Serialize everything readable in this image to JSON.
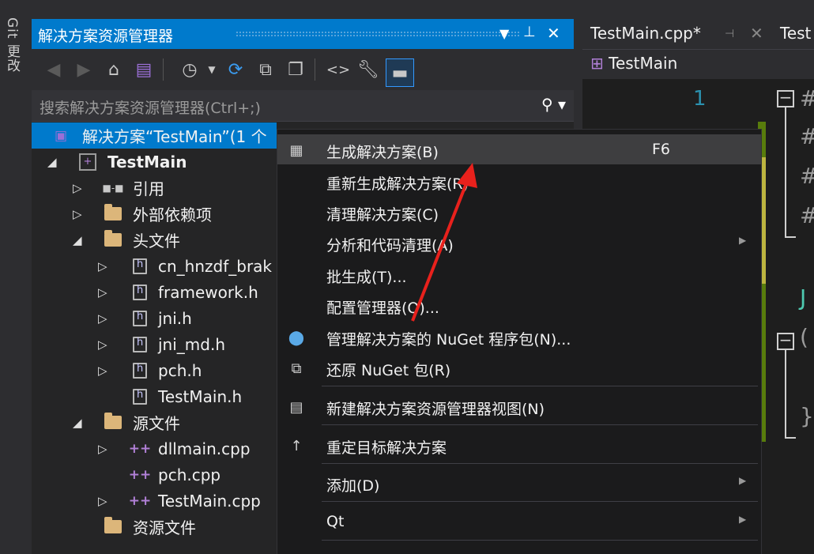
{
  "left_strip": {
    "label": "Git 更改"
  },
  "solution_explorer": {
    "title": "解决方案资源管理器",
    "title_controls": [
      "▼",
      "📌",
      "✕"
    ],
    "search_placeholder": "搜索解决方案资源管理器(Ctrl+;)",
    "tree": {
      "solution": "解决方案“TestMain”(1 个",
      "project": "TestMain",
      "references": "引用",
      "external_deps": "外部依赖项",
      "header_folder": "头文件",
      "headers": [
        "cn_hnzdf_brak",
        "framework.h",
        "jni.h",
        "jni_md.h",
        "pch.h",
        "TestMain.h"
      ],
      "source_folder": "源文件",
      "sources": [
        "dllmain.cpp",
        "pch.cpp",
        "TestMain.cpp"
      ],
      "resource_folder": "资源文件"
    }
  },
  "editor": {
    "tabs": [
      "TestMain.cpp*",
      "Test"
    ],
    "nav_scope": "TestMain",
    "line_number": "1"
  },
  "context_menu": {
    "items": [
      {
        "label": "生成解决方案(B)",
        "shortcut": "F6"
      },
      {
        "label": "重新生成解决方案(R)"
      },
      {
        "label": "清理解决方案(C)"
      },
      {
        "label": "分析和代码清理(A)"
      },
      {
        "label": "批生成(T)..."
      },
      {
        "label": "配置管理器(O)..."
      },
      {
        "label": "管理解决方案的 NuGet 程序包(N)..."
      },
      {
        "label": "还原 NuGet 包(R)"
      },
      {
        "label": "新建解决方案资源管理器视图(N)"
      },
      {
        "label": "重定目标解决方案"
      },
      {
        "label": "添加(D)"
      },
      {
        "label": "Qt"
      }
    ]
  },
  "colors": {
    "accent": "#007acc",
    "annotation_arrow": "#e8211c"
  }
}
